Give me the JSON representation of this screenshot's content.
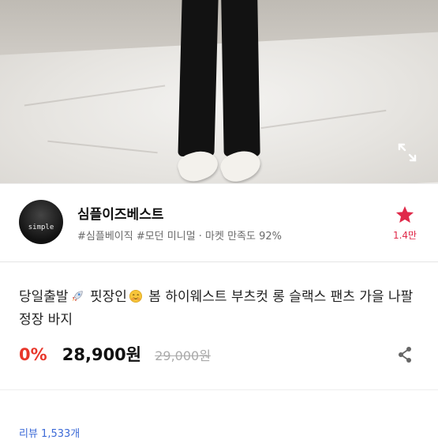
{
  "hero": {
    "expand_icon": "expand-icon"
  },
  "seller": {
    "name": "심플이즈베스트",
    "avatar_text": "simple",
    "tags": "#심플베이직 #모던 미니멀 · 마켓 만족도 92%",
    "like_count": "1.4만",
    "star_icon": "star-icon",
    "accent_color": "#e02a4a"
  },
  "product": {
    "title_part1": "당일출발",
    "title_part2": " 핏장인",
    "title_part3": " 봄 하이웨스트 부츠컷 롱 슬랙스 팬츠 가을 나팔 정장 바지",
    "emoji_1": "rocket-emoji",
    "emoji_2": "smile-emoji",
    "discount": "0%",
    "price": "28,900원",
    "original_price": "29,000원",
    "discount_color": "#e8372b"
  },
  "share_icon": "share-icon",
  "review": {
    "label": "리뷰 1,533개"
  }
}
